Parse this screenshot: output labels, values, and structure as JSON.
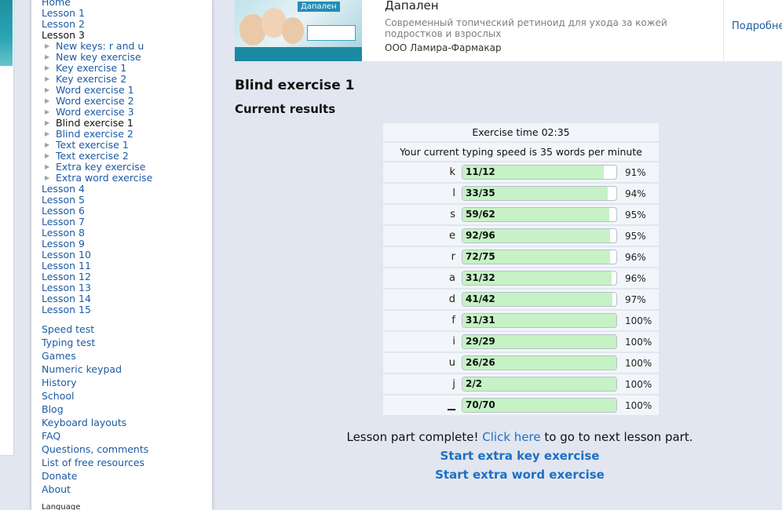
{
  "sidebar": {
    "top_items": [
      {
        "label": "Home",
        "current": false
      },
      {
        "label": "Lesson 1",
        "current": false
      },
      {
        "label": "Lesson 2",
        "current": false
      },
      {
        "label": "Lesson 3",
        "current": true
      }
    ],
    "sub_items": [
      {
        "label": "New keys: r and u",
        "current": false
      },
      {
        "label": "New key exercise",
        "current": false
      },
      {
        "label": "Key exercise 1",
        "current": false
      },
      {
        "label": "Key exercise 2",
        "current": false
      },
      {
        "label": "Word exercise 1",
        "current": false
      },
      {
        "label": "Word exercise 2",
        "current": false
      },
      {
        "label": "Word exercise 3",
        "current": false
      },
      {
        "label": "Blind exercise 1",
        "current": true
      },
      {
        "label": "Blind exercise 2",
        "current": false
      },
      {
        "label": "Text exercise 1",
        "current": false
      },
      {
        "label": "Text exercise 2",
        "current": false
      },
      {
        "label": "Extra key exercise",
        "current": false
      },
      {
        "label": "Extra word exercise",
        "current": false
      }
    ],
    "lessons": [
      "Lesson 4",
      "Lesson 5",
      "Lesson 6",
      "Lesson 7",
      "Lesson 8",
      "Lesson 9",
      "Lesson 10",
      "Lesson 11",
      "Lesson 12",
      "Lesson 13",
      "Lesson 14",
      "Lesson 15"
    ],
    "bottom_items": [
      "Speed test",
      "Typing test",
      "Games",
      "Numeric keypad",
      "History",
      "School",
      "Blog",
      "Keyboard layouts",
      "FAQ",
      "Questions, comments",
      "List of free resources",
      "Donate",
      "About"
    ],
    "language_label": "Language"
  },
  "ad": {
    "brand": "Дапален",
    "title": "Дапален",
    "description": "Современный топический ретиноид для ухода за кожей подростков и взрослых",
    "company": "ООО Ламира-Фармакар",
    "more_label": "Подробне"
  },
  "page_title": "Blind exercise 1",
  "results_title": "Current results",
  "results": {
    "exercise_time": "Exercise time 02:35",
    "speed": "Your current typing speed is 35 words per minute",
    "rows": [
      {
        "key": "k",
        "correct": 11,
        "total": 12,
        "score": "11/12",
        "percent": "91%",
        "fill": 0.917
      },
      {
        "key": "l",
        "correct": 33,
        "total": 35,
        "score": "33/35",
        "percent": "94%",
        "fill": 0.943
      },
      {
        "key": "s",
        "correct": 59,
        "total": 62,
        "score": "59/62",
        "percent": "95%",
        "fill": 0.952
      },
      {
        "key": "e",
        "correct": 92,
        "total": 96,
        "score": "92/96",
        "percent": "95%",
        "fill": 0.958
      },
      {
        "key": "r",
        "correct": 72,
        "total": 75,
        "score": "72/75",
        "percent": "96%",
        "fill": 0.96
      },
      {
        "key": "a",
        "correct": 31,
        "total": 32,
        "score": "31/32",
        "percent": "96%",
        "fill": 0.969
      },
      {
        "key": "d",
        "correct": 41,
        "total": 42,
        "score": "41/42",
        "percent": "97%",
        "fill": 0.976
      },
      {
        "key": "f",
        "correct": 31,
        "total": 31,
        "score": "31/31",
        "percent": "100%",
        "fill": 1.0
      },
      {
        "key": "i",
        "correct": 29,
        "total": 29,
        "score": "29/29",
        "percent": "100%",
        "fill": 1.0
      },
      {
        "key": "u",
        "correct": 26,
        "total": 26,
        "score": "26/26",
        "percent": "100%",
        "fill": 1.0
      },
      {
        "key": "j",
        "correct": 2,
        "total": 2,
        "score": "2/2",
        "percent": "100%",
        "fill": 1.0
      },
      {
        "key": "▁",
        "correct": 70,
        "total": 70,
        "score": "70/70",
        "percent": "100%",
        "fill": 1.0
      }
    ]
  },
  "complete": {
    "prefix": "Lesson part complete!",
    "link": "Click here",
    "suffix": "to go to next lesson part."
  },
  "extra_key_link": "Start extra key exercise",
  "extra_word_link": "Start extra word exercise",
  "colors": {
    "link": "#1d5aa5",
    "bar_fill": "#c6f2c5",
    "background": "#e1e6f0"
  }
}
